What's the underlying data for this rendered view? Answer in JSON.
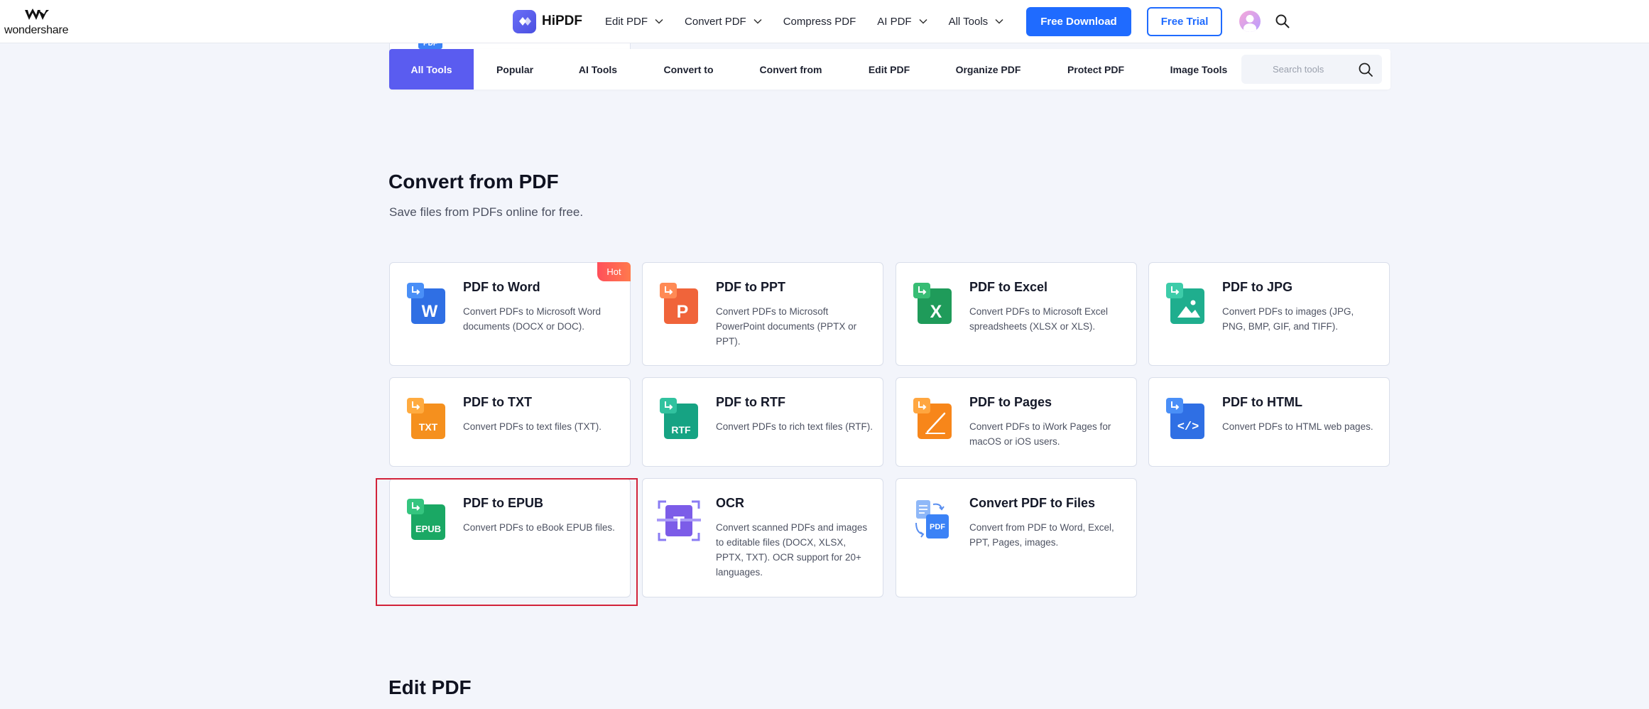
{
  "header": {
    "brand": "wondershare",
    "app_name": "HiPDF",
    "nav": [
      {
        "label": "Edit PDF",
        "dropdown": true
      },
      {
        "label": "Convert PDF",
        "dropdown": true
      },
      {
        "label": "Compress PDF",
        "dropdown": false
      },
      {
        "label": "AI PDF",
        "dropdown": true
      },
      {
        "label": "All Tools",
        "dropdown": true
      }
    ],
    "download_label": "Free Download",
    "trial_label": "Free Trial",
    "accent_color": "#1f6bff"
  },
  "categories": {
    "tabs": [
      "All Tools",
      "Popular",
      "AI Tools",
      "Convert to",
      "Convert from",
      "Edit PDF",
      "Organize PDF",
      "Protect PDF",
      "Image Tools"
    ],
    "active": "All Tools",
    "search_placeholder": "Search tools"
  },
  "section": {
    "title": "Convert from PDF",
    "subtitle": "Save files from PDFs online for free.",
    "cards": [
      {
        "title": "PDF to Word",
        "desc": "Convert PDFs to Microsoft Word documents (DOCX or DOC).",
        "icon": "word-icon",
        "badge": "Hot"
      },
      {
        "title": "PDF to PPT",
        "desc": "Convert PDFs to Microsoft PowerPoint documents (PPTX or PPT).",
        "icon": "ppt-icon"
      },
      {
        "title": "PDF to Excel",
        "desc": "Convert PDFs to Microsoft Excel spreadsheets (XLSX or XLS).",
        "icon": "excel-icon"
      },
      {
        "title": "PDF to JPG",
        "desc": "Convert PDFs to images (JPG, PNG, BMP, GIF, and TIFF).",
        "icon": "jpg-icon"
      },
      {
        "title": "PDF to TXT",
        "desc": "Convert PDFs to text files (TXT).",
        "icon": "txt-icon",
        "icon_text": "TXT"
      },
      {
        "title": "PDF to RTF",
        "desc": "Convert PDFs to rich text files (RTF).",
        "icon": "rtf-icon",
        "icon_text": "RTF"
      },
      {
        "title": "PDF to Pages",
        "desc": "Convert PDFs to iWork Pages for macOS or iOS users.",
        "icon": "pages-icon"
      },
      {
        "title": "PDF to HTML",
        "desc": "Convert PDFs to HTML web pages.",
        "icon": "html-icon",
        "icon_text": "</>"
      },
      {
        "title": "PDF to EPUB",
        "desc": "Convert PDFs to eBook EPUB files.",
        "icon": "epub-icon",
        "icon_text": "EPUB"
      },
      {
        "title": "OCR",
        "desc": "Convert scanned PDFs and images to editable files (DOCX, XLSX, PPTX, TXT). OCR support for 20+ languages.",
        "icon": "ocr-icon"
      },
      {
        "title": "Convert PDF to Files",
        "desc": "Convert from PDF to Word, Excel, PPT, Pages, images.",
        "icon": "pdf-files-icon",
        "icon_text": "PDF"
      }
    ]
  },
  "next_section": {
    "title": "Edit PDF"
  },
  "peek_card": {
    "icon_text": "PDF"
  },
  "icon_letters": {
    "word": "W",
    "ppt": "P",
    "excel": "X",
    "ocr": "T"
  }
}
